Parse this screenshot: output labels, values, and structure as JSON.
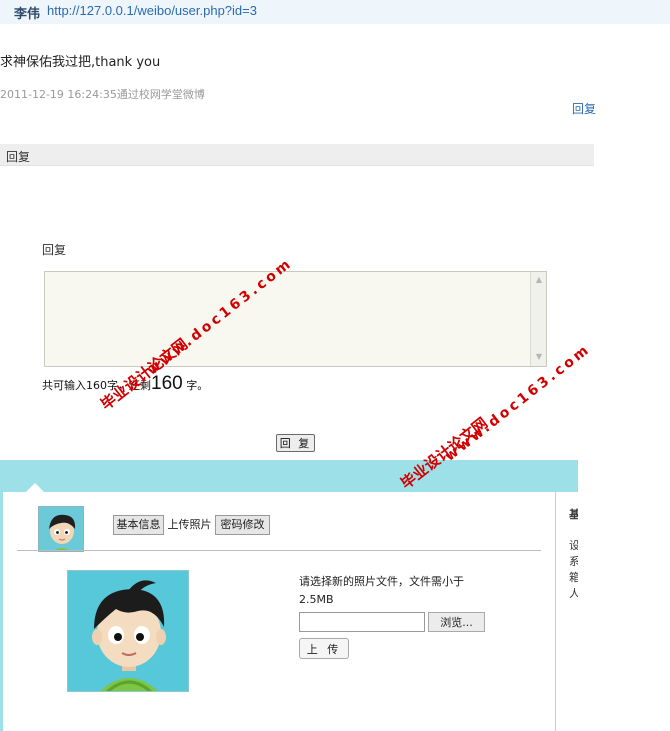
{
  "post": {
    "author": "李伟",
    "url": "http://127.0.0.1/weibo/user.php?id=3",
    "text": "求神保佑我过把,thank you",
    "meta": "2011-12-19 16:24:35通过校网学堂微博",
    "reply_link": "回复"
  },
  "reply_section": {
    "header": "回复",
    "label": "回复",
    "textarea_value": "",
    "counter_prefix": "共可输入160字，还剩",
    "counter_remaining": "160",
    "counter_suffix": "字。",
    "submit_label": "回 复"
  },
  "profile_panel": {
    "tabs": [
      "基本信息",
      "上传照片",
      "密码修改"
    ],
    "active_tab": "上传照片",
    "upload_tip": "请选择新的照片文件，文件需小于2.5MB",
    "file_value": "",
    "browse_label": "浏览...",
    "upload_label": "上 传",
    "side_texts": [
      "基",
      "设",
      "系",
      "箱",
      "人"
    ]
  },
  "watermarks": {
    "site_name": "毕业设计论文网",
    "site_url": "www.doc163.com"
  },
  "colors": {
    "link": "#2b6bb0",
    "panel_bg": "#9ee0e8",
    "watermark": "#d00000"
  }
}
